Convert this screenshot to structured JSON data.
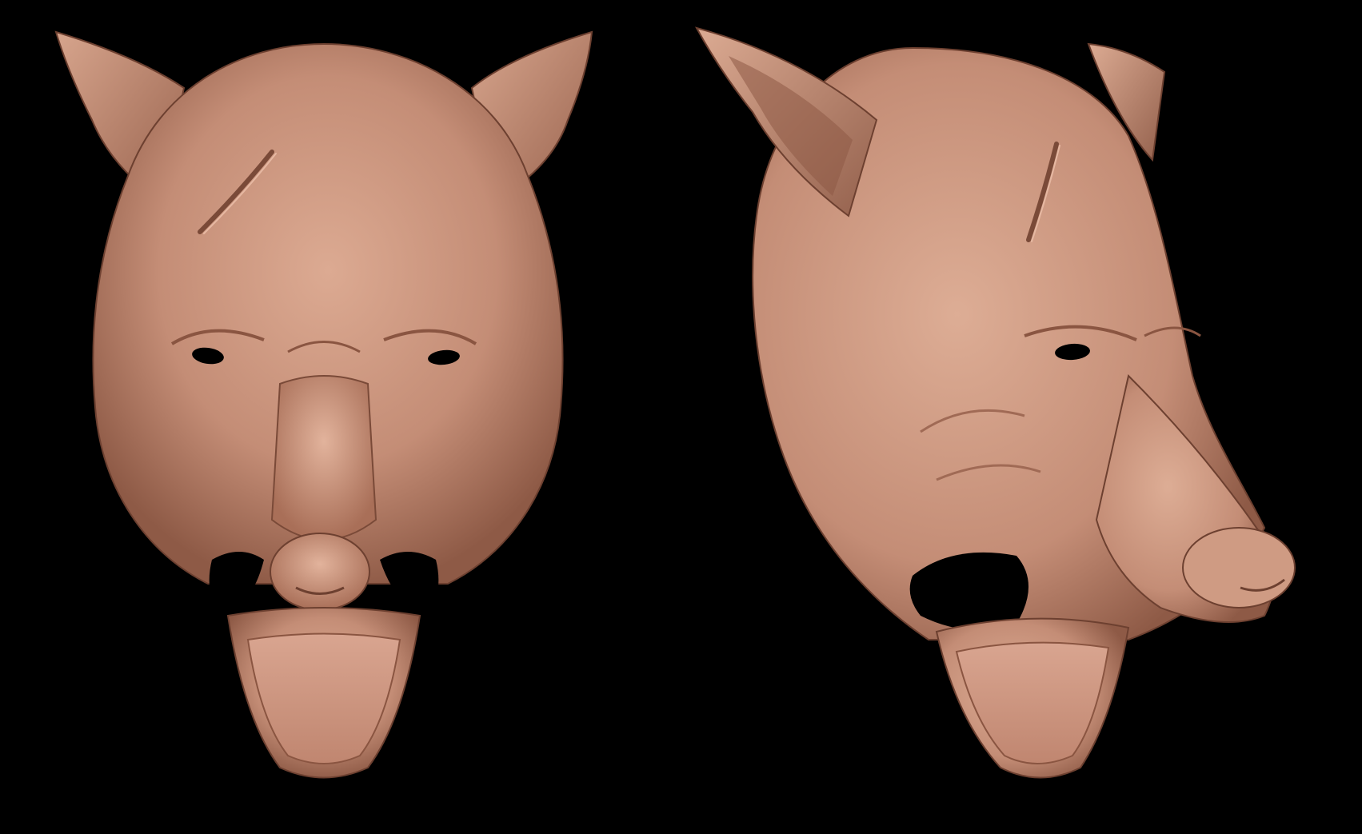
{
  "scene": {
    "background_color": "#000000",
    "material_color": "#c8917a",
    "material_shadow": "#7a4a38",
    "material_highlight": "#e6b8a2"
  },
  "views": [
    {
      "id": "front",
      "subject": "wolf-head-mask-front"
    },
    {
      "id": "side",
      "subject": "wolf-head-mask-three-quarter"
    }
  ]
}
